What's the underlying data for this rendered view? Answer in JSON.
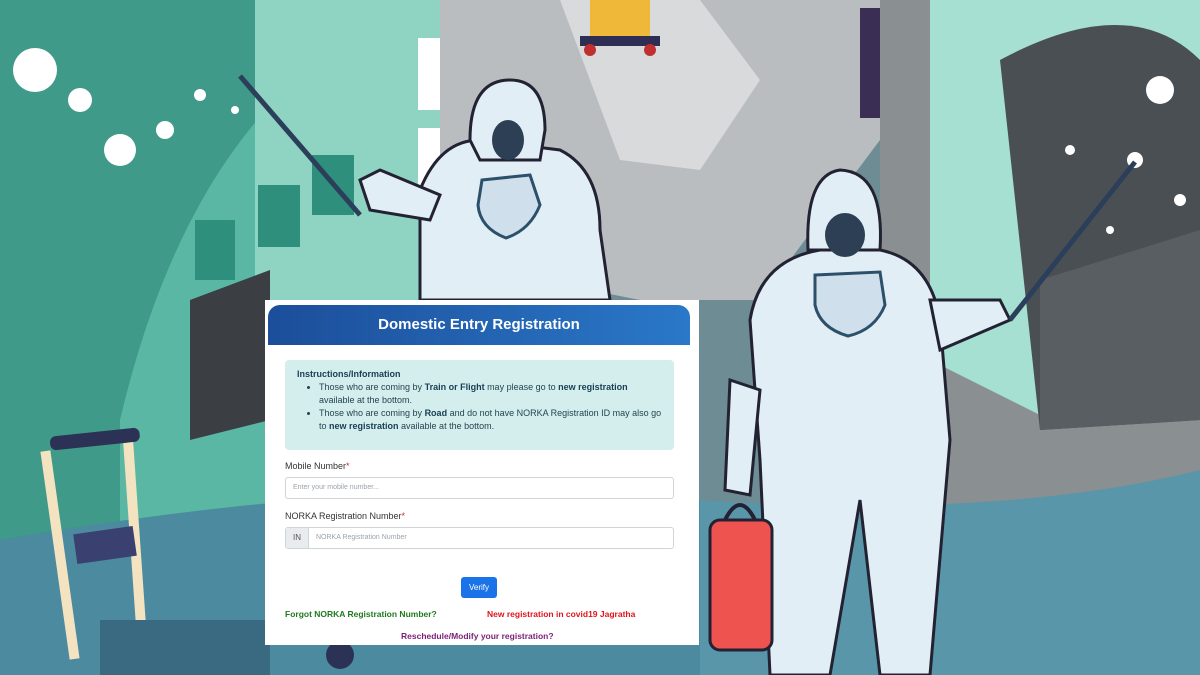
{
  "form": {
    "title": "Domestic Entry Registration",
    "instructions": {
      "heading": "Instructions/Information",
      "item1": {
        "pre": "Those who are coming by ",
        "bold1": "Train or Flight",
        "mid": " may please go to ",
        "bold2": "new registration",
        "post": " available at the bottom."
      },
      "item2": {
        "pre": "Those who are coming by ",
        "bold1": "Road",
        "mid": " and do not have NORKA Registration ID may also go to ",
        "bold2": "new registration",
        "post": " available at the bottom."
      }
    },
    "mobile_label": "Mobile Number",
    "mobile_placeholder": "Enter your mobile number...",
    "norka_label": "NORKA Registration Number",
    "norka_prefix": "IN",
    "norka_placeholder": "NORKA Registration Number",
    "required_mark": "*",
    "verify_label": "Verify",
    "forgot_link": "Forgot NORKA Registration Number?",
    "new_registration_link": "New registration in covid19 Jagratha",
    "reschedule_link": "Reschedule/Modify your registration?"
  },
  "colors": {
    "header": "#1c4e9a",
    "button": "#1a73e8",
    "info_box": "#d4eeee",
    "link_green": "#1f7a1f",
    "link_red": "#e0141a",
    "link_purple": "#7a1f7a"
  }
}
